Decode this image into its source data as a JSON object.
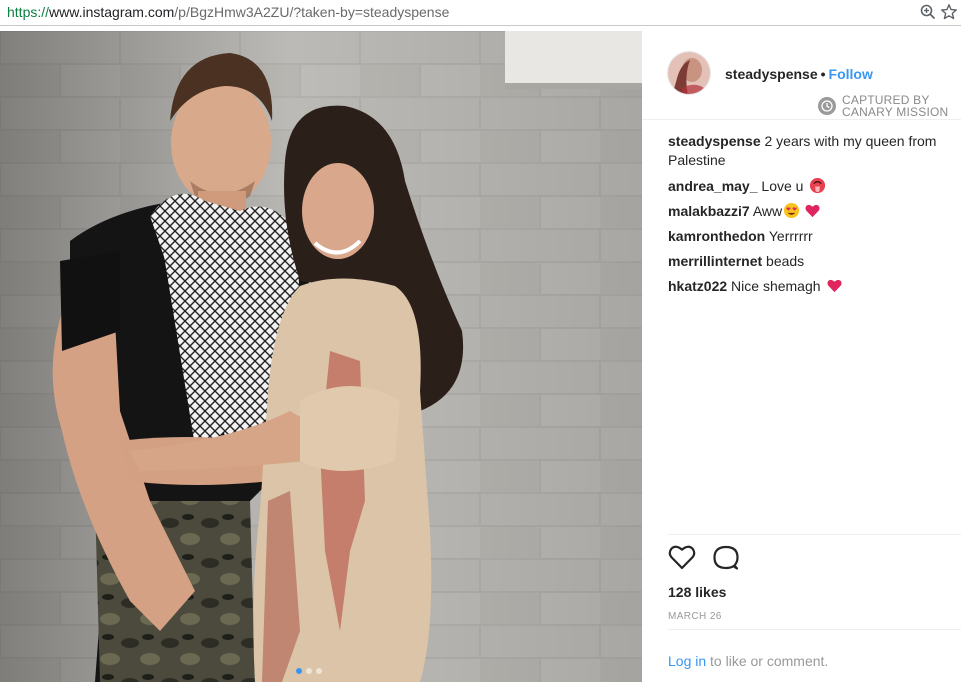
{
  "browser": {
    "url_scheme": "https://",
    "url_host": "www.instagram.com",
    "url_path": "/p/BgzHmw3A2ZU/?taken-by=steadyspense",
    "icons": [
      "zoom-icon",
      "star-icon"
    ]
  },
  "post": {
    "image_alt": "Photo of a couple posing in front of a cinder block wall",
    "carousel_dots": 3,
    "carousel_active": 1
  },
  "header": {
    "username": "steadyspense",
    "separator": "•",
    "follow_label": "Follow",
    "captured_line1": "CAPTURED BY",
    "captured_line2": "CANARY MISSION"
  },
  "caption": {
    "username": "steadyspense",
    "text": "2 years with my queen from Palestine"
  },
  "comments": [
    {
      "username": "andrea_may_",
      "text": "Love u",
      "emoji": "tongue-emoji"
    },
    {
      "username": "malakbazzi7",
      "text": "Aww",
      "emoji": "heart-eyes-emoji heart-emoji"
    },
    {
      "username": "kamronthedon",
      "text": "Yerrrrrr"
    },
    {
      "username": "merrillinternet",
      "text": "beads"
    },
    {
      "username": "hkatz022",
      "text": "Nice shemagh",
      "emoji": "heart-emoji"
    }
  ],
  "actions": {
    "likes": "128 likes",
    "date": "MARCH 26",
    "login_link": "Log in",
    "login_rest": " to like or comment."
  },
  "colors": {
    "link_blue": "#3897f0",
    "heart_red": "#e0245e",
    "text": "#262626",
    "muted": "#999999"
  }
}
